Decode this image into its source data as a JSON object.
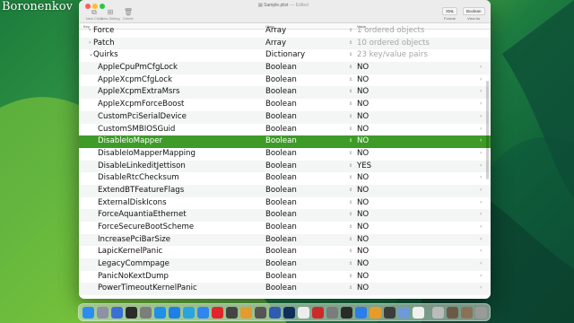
{
  "watermark": "Boronenkov",
  "window": {
    "filename": "Sample.plist",
    "edited": "— Edited",
    "toolbar": {
      "new_child": "New Child",
      "new_sibling": "New Sibling",
      "delete": "Delete",
      "format_value": "XML",
      "format_label": "Format",
      "view_as_value": "Boolean",
      "view_as_label": "View As"
    },
    "columns": {
      "key": "Key",
      "class": "Class",
      "value": "Value"
    }
  },
  "rows": [
    {
      "key": "Force",
      "type": "Array",
      "value": "1 ordered objects",
      "muted": true,
      "level": 0
    },
    {
      "key": "Patch",
      "type": "Array",
      "value": "10 ordered objects",
      "muted": true,
      "level": 0
    },
    {
      "key": "Quirks",
      "type": "Dictionary",
      "value": "23 key/value pairs",
      "muted": true,
      "level": 0,
      "expanded": true
    },
    {
      "key": "AppleCpuPmCfgLock",
      "type": "Boolean",
      "value": "NO",
      "level": 1
    },
    {
      "key": "AppleXcpmCfgLock",
      "type": "Boolean",
      "value": "NO",
      "level": 1
    },
    {
      "key": "AppleXcpmExtraMsrs",
      "type": "Boolean",
      "value": "NO",
      "level": 1
    },
    {
      "key": "AppleXcpmForceBoost",
      "type": "Boolean",
      "value": "NO",
      "level": 1
    },
    {
      "key": "CustomPciSerialDevice",
      "type": "Boolean",
      "value": "NO",
      "level": 1
    },
    {
      "key": "CustomSMBIOSGuid",
      "type": "Boolean",
      "value": "NO",
      "level": 1
    },
    {
      "key": "DisableIoMapper",
      "type": "Boolean",
      "value": "NO",
      "level": 1,
      "selected": true
    },
    {
      "key": "DisableIoMapperMapping",
      "type": "Boolean",
      "value": "NO",
      "level": 1
    },
    {
      "key": "DisableLinkeditJettison",
      "type": "Boolean",
      "value": "YES",
      "level": 1
    },
    {
      "key": "DisableRtcChecksum",
      "type": "Boolean",
      "value": "NO",
      "level": 1
    },
    {
      "key": "ExtendBTFeatureFlags",
      "type": "Boolean",
      "value": "NO",
      "level": 1
    },
    {
      "key": "ExternalDiskIcons",
      "type": "Boolean",
      "value": "NO",
      "level": 1
    },
    {
      "key": "ForceAquantiaEthernet",
      "type": "Boolean",
      "value": "NO",
      "level": 1
    },
    {
      "key": "ForceSecureBootScheme",
      "type": "Boolean",
      "value": "NO",
      "level": 1
    },
    {
      "key": "IncreasePciBarSize",
      "type": "Boolean",
      "value": "NO",
      "level": 1
    },
    {
      "key": "LapicKernelPanic",
      "type": "Boolean",
      "value": "NO",
      "level": 1
    },
    {
      "key": "LegacyCommpage",
      "type": "Boolean",
      "value": "NO",
      "level": 1
    },
    {
      "key": "PanicNoKextDump",
      "type": "Boolean",
      "value": "NO",
      "level": 1
    },
    {
      "key": "PowerTimeoutKernelPanic",
      "type": "Boolean",
      "value": "NO",
      "level": 1
    }
  ],
  "colors": {
    "selection": "#3e9b28",
    "close": "#fe5f57",
    "minimize": "#febc2e",
    "maximize": "#28c840"
  },
  "dock": [
    {
      "name": "finder-icon",
      "color": "#2d8cf0"
    },
    {
      "name": "launchpad-icon",
      "color": "#8f8fa8"
    },
    {
      "name": "mission-control-icon",
      "color": "#3b6fd6"
    },
    {
      "name": "terminal-icon",
      "color": "#2b2b2b"
    },
    {
      "name": "system-settings-icon",
      "color": "#7d7d7d"
    },
    {
      "name": "safari-icon",
      "color": "#1f8fe8"
    },
    {
      "name": "app-store-icon",
      "color": "#1f7fe8"
    },
    {
      "name": "telegram-icon",
      "color": "#2aa3e0"
    },
    {
      "name": "mail-icon",
      "color": "#2f86f0"
    },
    {
      "name": "opera-icon",
      "color": "#e0262b"
    },
    {
      "name": "final-cut-icon",
      "color": "#444444"
    },
    {
      "name": "photos-icon",
      "color": "#e39a2f"
    },
    {
      "name": "music-app-icon",
      "color": "#555555"
    },
    {
      "name": "hackintool-icon",
      "color": "#2f5cb0"
    },
    {
      "name": "photoshop-icon",
      "color": "#0f2f5a"
    },
    {
      "name": "text-editor-icon",
      "color": "#ededed"
    },
    {
      "name": "propertree-icon",
      "color": "#cc2a2a"
    },
    {
      "name": "disk-utility-icon",
      "color": "#7c7c7c"
    },
    {
      "name": "chatgpt-icon",
      "color": "#2a2a2a"
    },
    {
      "name": "xcode-icon",
      "color": "#2b7de9"
    },
    {
      "name": "pages-icon",
      "color": "#e79b2a"
    },
    {
      "name": "activity-monitor-icon",
      "color": "#3c3c3c"
    },
    {
      "name": "preview-icon",
      "color": "#6d9ad6"
    },
    {
      "name": "sublime-icon",
      "color": "#f0f0f0"
    },
    {
      "name": "utility-icon",
      "color": "#bbbbbb"
    },
    {
      "name": "folder-icon",
      "color": "#6b5a45"
    },
    {
      "name": "downloads-icon",
      "color": "#8a7257"
    },
    {
      "name": "trash-icon",
      "color": "#9a9a9a"
    }
  ]
}
